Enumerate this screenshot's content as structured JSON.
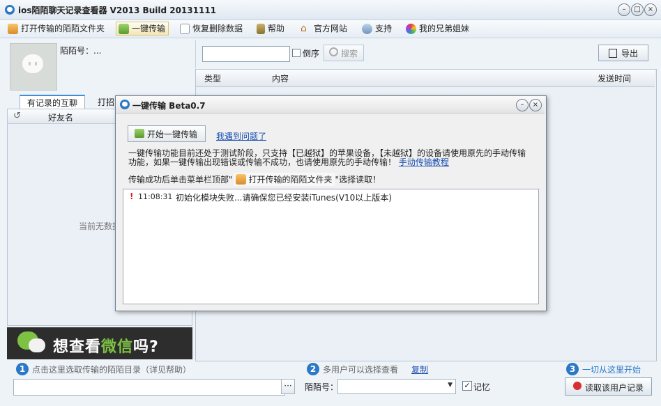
{
  "window": {
    "title": "ios陌陌聊天记录查看器 V2013 Build 20131111"
  },
  "menu": [
    {
      "label": "打开传输的陌陌文件夹",
      "icon": "folder-icon"
    },
    {
      "label": "一键传输",
      "icon": "transfer-icon"
    },
    {
      "label": "恢复删除数据",
      "icon": "restore-icon"
    },
    {
      "label": "帮助",
      "icon": "help-book-icon"
    },
    {
      "label": "官方网站",
      "icon": "home-icon"
    },
    {
      "label": "支持",
      "icon": "support-user-icon"
    },
    {
      "label": "我的兄弟姐妹",
      "icon": "color-wheel-icon"
    }
  ],
  "profile": {
    "momo_id_label": "陌陌号：..."
  },
  "left_tabs": [
    "有记录的互聊",
    "打招"
  ],
  "friend_list": {
    "refresh_symbol": "↺",
    "header": "好友名",
    "empty_text": "当前无数据"
  },
  "banner": {
    "text_prefix": "想查看",
    "text_highlight": "微信",
    "text_suffix": "吗?"
  },
  "toolbar": {
    "search_value": "",
    "reverse_label": "倒序",
    "search_label": "搜索",
    "export_label": "导出"
  },
  "records_table": {
    "columns": [
      "类型",
      "内容",
      "发送时间"
    ]
  },
  "bottom": {
    "step1": {
      "num": "1",
      "text": "点击这里选取传输的陌陌目录（详见帮助）"
    },
    "step2": {
      "num": "2",
      "text": "多用户可以选择查看",
      "copy_link": "复制"
    },
    "step3": {
      "num": "3",
      "text": "一切从这里开始"
    },
    "dir_value": "",
    "browse_label": "···",
    "momo_label": "陌陌号：",
    "remember_label": "记忆",
    "remember_checked": "✓",
    "read_button": "读取该用户记录"
  },
  "dialog": {
    "title": "一键传输 Beta0.7",
    "start_button": "开始一键传输",
    "problem_link": "我遇到问题了",
    "desc_line1": "一键传输功能目前还处于测试阶段，只支持【已越狱】的苹果设备，【未越狱】的设备请使用原先的手动传输",
    "desc_line2": "功能，如果一键传输出现错误或传输不成功，也请使用原先的手动传输！",
    "manual_link": "手动传输教程",
    "hint_prefix": "传输成功后单击菜单栏顶部\"",
    "hint_button": "打开传输的陌陌文件夹",
    "hint_suffix": "\"选择读取！",
    "log": [
      {
        "marker": "!",
        "time": "11:08:31",
        "message": "初始化模块失败...请确保您已经安装iTunes(V10以上版本)"
      }
    ]
  },
  "colors": {
    "accent": "#2a78c6",
    "link": "#1a4fb0",
    "wechat_green": "#7dc242",
    "error_red": "#d42020"
  }
}
